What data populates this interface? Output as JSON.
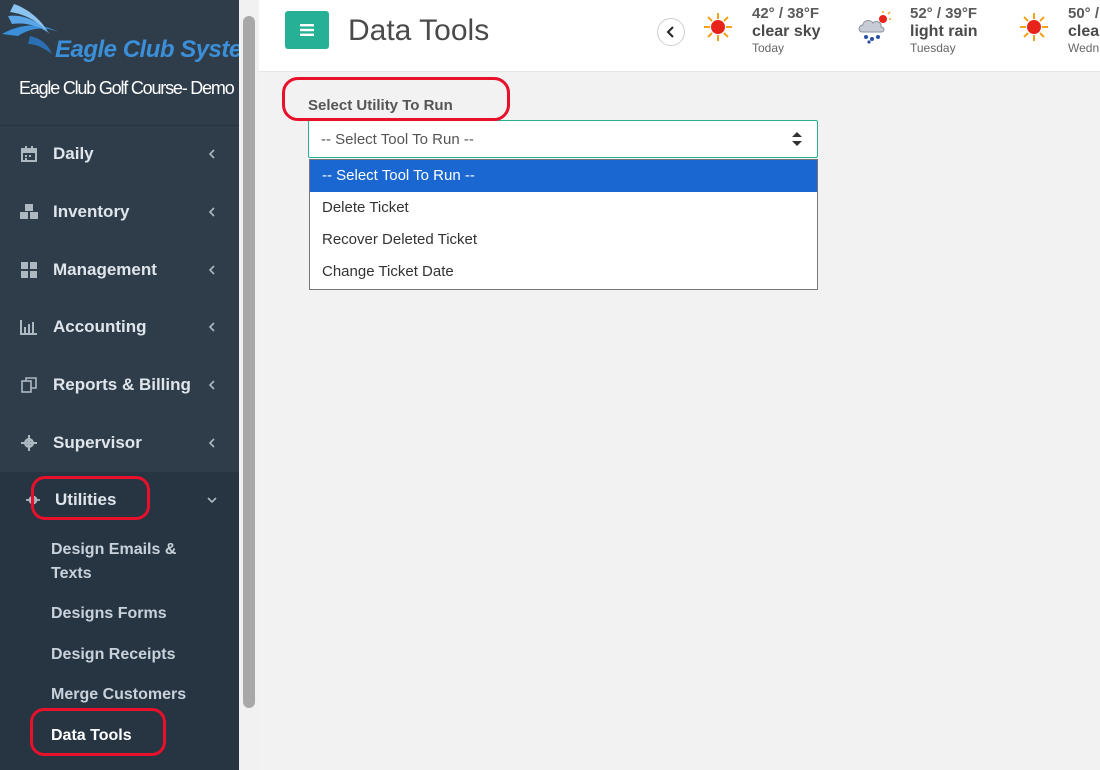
{
  "brand": {
    "name": "Eagle Club Systems",
    "subtitle": "Eagle Club Golf Course- Demo"
  },
  "sidebar": {
    "items": [
      {
        "label": "Daily",
        "icon": "calendar-icon"
      },
      {
        "label": "Inventory",
        "icon": "cubes-icon"
      },
      {
        "label": "Management",
        "icon": "grid-icon"
      },
      {
        "label": "Accounting",
        "icon": "bar-chart-icon"
      },
      {
        "label": "Reports & Billing",
        "icon": "copy-icon"
      },
      {
        "label": "Supervisor",
        "icon": "gear-icon"
      },
      {
        "label": "Utilities",
        "icon": "gears-icon"
      }
    ],
    "utilities_sub": [
      {
        "label": "Design Emails & Texts"
      },
      {
        "label": "Designs Forms"
      },
      {
        "label": "Design Receipts"
      },
      {
        "label": "Merge Customers"
      },
      {
        "label": "Data Tools"
      }
    ]
  },
  "topbar": {
    "title": "Data Tools",
    "weather": [
      {
        "temp": "42° / 38°F",
        "desc": "clear sky",
        "day": "Today",
        "icon": "sun-icon"
      },
      {
        "temp": "52° / 39°F",
        "desc": "light rain",
        "day": "Tuesday",
        "icon": "rain-cloud-icon"
      },
      {
        "temp": "50° /",
        "desc": "clear",
        "day": "Wedn",
        "icon": "sun-icon"
      }
    ]
  },
  "main": {
    "label": "Select Utility To Run",
    "select_value": "-- Select Tool To Run --",
    "options": [
      "-- Select Tool To Run --",
      "Delete Ticket",
      "Recover Deleted Ticket",
      "Change Ticket Date"
    ]
  },
  "colors": {
    "sidebar_bg": "#2f3d4a",
    "accent": "#26b095",
    "highlight": "#1a67d2",
    "annotation": "#e8102a"
  }
}
